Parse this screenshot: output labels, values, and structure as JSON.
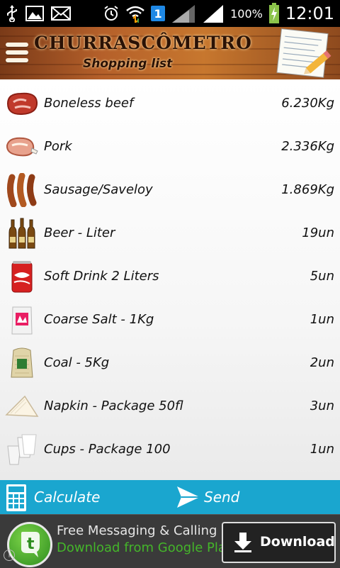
{
  "status_bar": {
    "notification_icons": [
      "usb-icon",
      "image-icon",
      "mail-icon",
      "alarm-icon",
      "wifi-icon",
      "sim-icon",
      "signal-icon"
    ],
    "sim_badge": "1",
    "battery_percent": "100%",
    "clock": "12:01"
  },
  "header": {
    "title": "CHURRASCÔMETRO",
    "subtitle": "Shopping list"
  },
  "items": [
    {
      "name": "Boneless beef",
      "qty": "6.230Kg",
      "icon": "beef-icon"
    },
    {
      "name": "Pork",
      "qty": "2.336Kg",
      "icon": "pork-icon"
    },
    {
      "name": "Sausage/Saveloy",
      "qty": "1.869Kg",
      "icon": "sausage-icon"
    },
    {
      "name": "Beer - Liter",
      "qty": "19un",
      "icon": "beer-icon"
    },
    {
      "name": "Soft Drink 2 Liters",
      "qty": "5un",
      "icon": "soda-can-icon"
    },
    {
      "name": "Coarse Salt - 1Kg",
      "qty": "1un",
      "icon": "salt-bag-icon"
    },
    {
      "name": "Coal - 5Kg",
      "qty": "2un",
      "icon": "coal-bag-icon"
    },
    {
      "name": "Napkin - Package 50fl",
      "qty": "3un",
      "icon": "napkin-icon"
    },
    {
      "name": "Cups - Package 100",
      "qty": "1un",
      "icon": "cups-icon"
    }
  ],
  "actions": {
    "calculate": "Calculate",
    "send": "Send"
  },
  "ad": {
    "line1": "Free Messaging & Calling",
    "line2": "Download from Google Pla",
    "download": "Download",
    "info": "i"
  },
  "colors": {
    "action_bar": "#1aa6cf",
    "ad_green": "#44b52a",
    "header_wood": "#b5602a"
  }
}
